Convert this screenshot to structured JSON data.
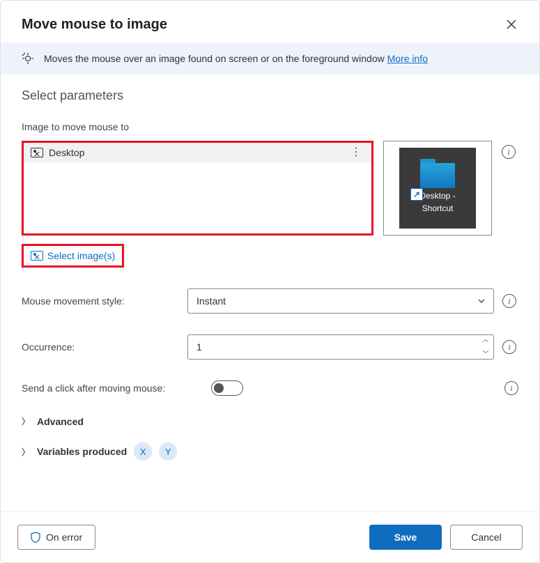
{
  "title": "Move mouse to image",
  "banner": {
    "text": "Moves the mouse over an image found on screen or on the foreground window",
    "link": "More info"
  },
  "section_title": "Select parameters",
  "image_field": {
    "label": "Image to move mouse to",
    "selected_item": "Desktop",
    "preview_caption_line1": "Desktop -",
    "preview_caption_line2": "Shortcut",
    "select_button": "Select image(s)"
  },
  "movement_style": {
    "label": "Mouse movement style:",
    "value": "Instant"
  },
  "occurrence": {
    "label": "Occurrence:",
    "value": "1"
  },
  "send_click": {
    "label": "Send a click after moving mouse:"
  },
  "advanced_label": "Advanced",
  "variables": {
    "label": "Variables produced",
    "vars": [
      "X",
      "Y"
    ]
  },
  "footer": {
    "on_error": "On error",
    "save": "Save",
    "cancel": "Cancel"
  }
}
